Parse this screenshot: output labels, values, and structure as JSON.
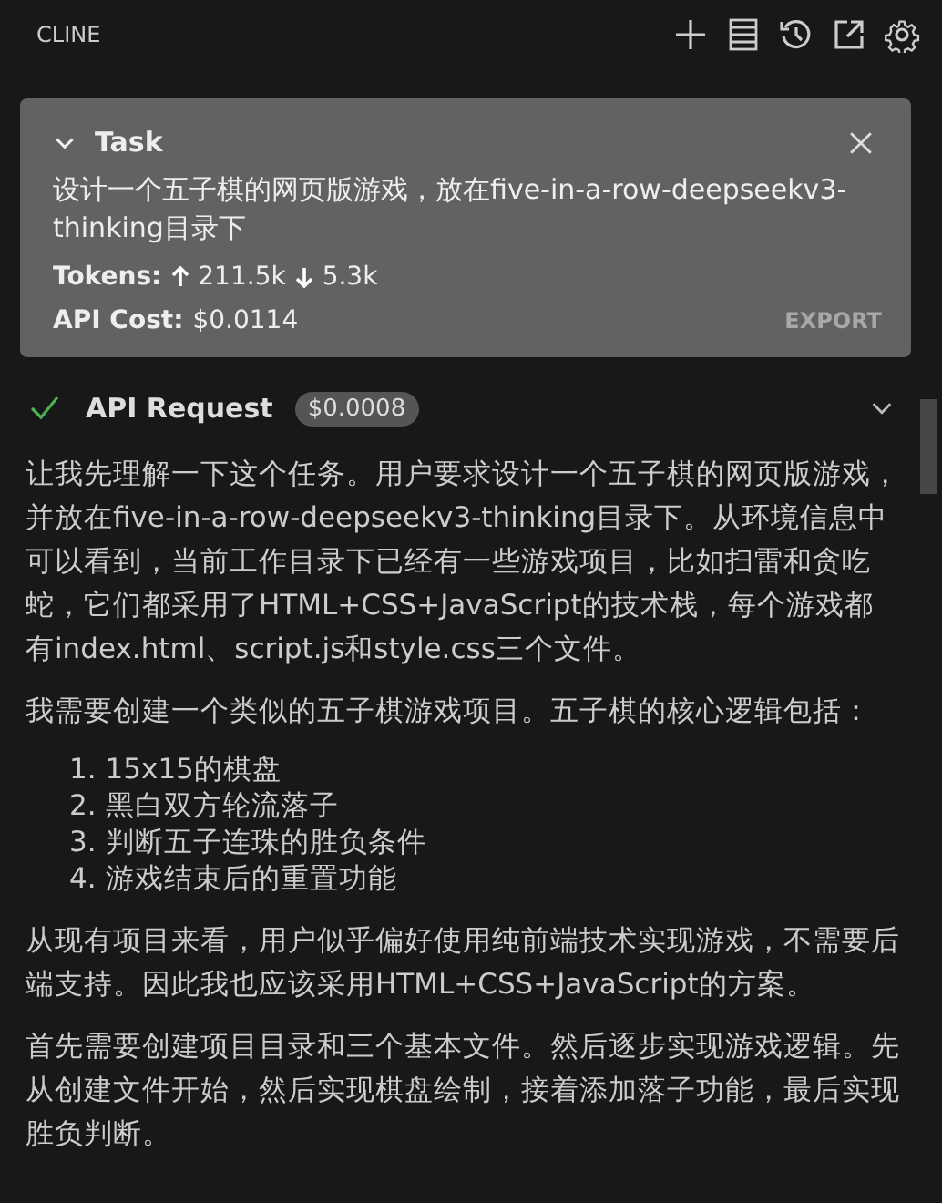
{
  "header": {
    "title": "CLINE"
  },
  "task": {
    "expanded": true,
    "title": "Task",
    "text": "设计一个五子棋的网页版游戏，放在five-in-a-row-deepseekv3-thinking目录下",
    "tokens_label": "Tokens:",
    "tokens_in": "211.5k",
    "tokens_out": "5.3k",
    "cost_label": "API Cost:",
    "cost": "$0.0114",
    "export": "EXPORT"
  },
  "request": {
    "done": true,
    "title": "API Request",
    "cost": "$0.0008",
    "expanded": false
  },
  "message": [
    {
      "kind": "paragraph",
      "text": "让我先理解一下这个任务。用户要求设计一个五子棋的网页版游戏，并放在five-in-a-row-deepseekv3-thinking目录下。从环境信息中可以看到，当前工作目录下已经有一些游戏项目，比如扫雷和贪吃蛇，它们都采用了HTML+CSS+JavaScript的技术栈，每个游戏都有index.html、script.js和style.css三个文件。"
    },
    {
      "kind": "paragraph",
      "text": "我需要创建一个类似的五子棋游戏项目。五子棋的核心逻辑包括："
    },
    {
      "kind": "list",
      "items": [
        {
          "number": "1.",
          "text": "15x15的棋盘"
        },
        {
          "number": "2.",
          "text": "黑白双方轮流落子"
        },
        {
          "number": "3.",
          "text": "判断五子连珠的胜负条件"
        },
        {
          "number": "4.",
          "text": "游戏结束后的重置功能"
        }
      ]
    },
    {
      "kind": "paragraph",
      "text": "从现有项目来看，用户似乎偏好使用纯前端技术实现游戏，不需要后端支持。因此我也应该采用HTML+CSS+JavaScript的方案。"
    },
    {
      "kind": "paragraph",
      "text": "首先需要创建项目目录和三个基本文件。然后逐步实现游戏逻辑。先从创建文件开始，然后实现棋盘绘制，接着添加落子功能，最后实现胜负判断。"
    }
  ]
}
